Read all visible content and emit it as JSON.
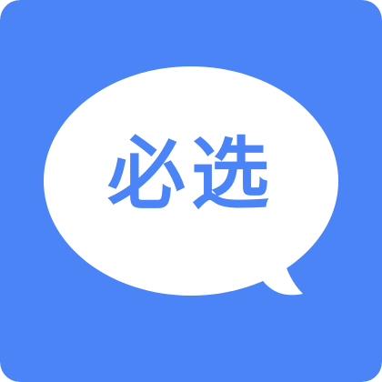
{
  "icon": {
    "name": "speech-bubble-icon",
    "background_color": "#4B84F7",
    "bubble_color": "#FFFFFF",
    "text_color": "#4B84F7",
    "text": "必选"
  }
}
